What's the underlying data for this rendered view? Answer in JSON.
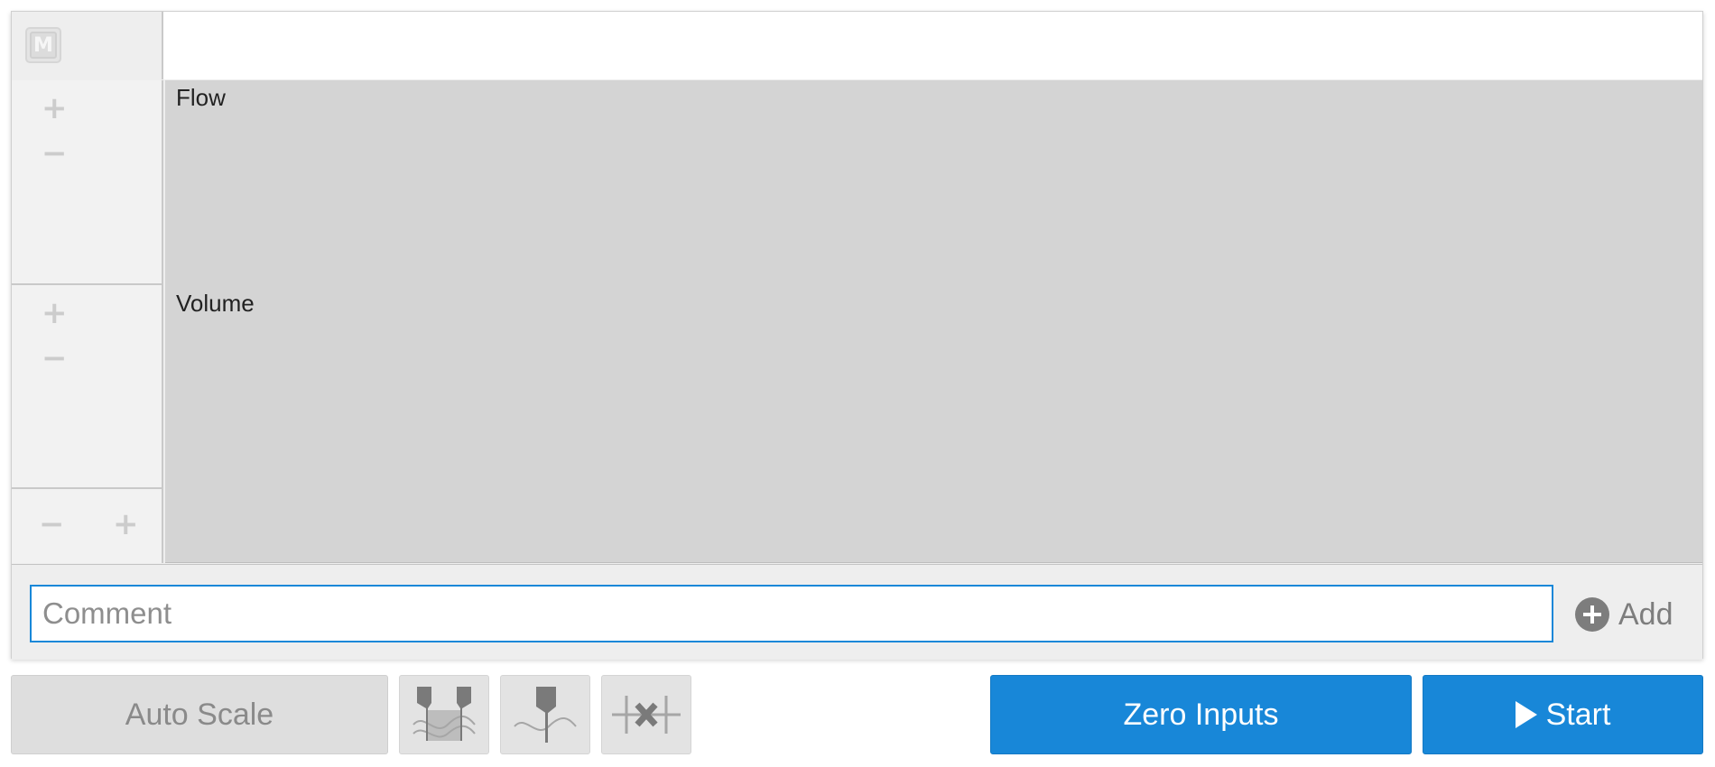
{
  "header": {
    "m_icon_letter": "M"
  },
  "channels": [
    {
      "title": "Flow",
      "zoom_in": "+",
      "zoom_out": "−"
    },
    {
      "title": "Volume",
      "zoom_in": "+",
      "zoom_out": "−"
    }
  ],
  "time_zoom": {
    "zoom_out": "−",
    "zoom_in": "+"
  },
  "comment": {
    "placeholder": "Comment",
    "value": "",
    "add_label": "Add"
  },
  "toolbar": {
    "auto_scale_label": "Auto Scale",
    "zero_inputs_label": "Zero Inputs",
    "start_label": "Start"
  },
  "colors": {
    "accent": "#1887d8",
    "plot_background": "#d4d4d4",
    "disabled_text": "#8a8a8a"
  }
}
